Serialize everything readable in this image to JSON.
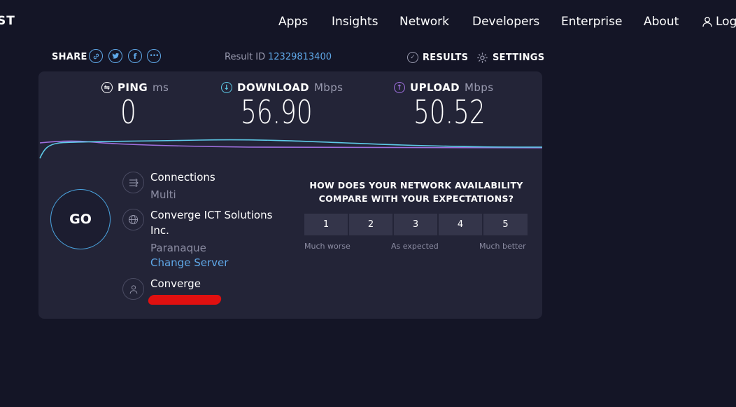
{
  "header": {
    "logo": "ST",
    "nav": [
      "Apps",
      "Insights",
      "Network",
      "Developers",
      "Enterprise",
      "About"
    ],
    "login": "Log"
  },
  "share": {
    "label": "SHARE",
    "icons": [
      "link-icon",
      "twitter-icon",
      "facebook-icon",
      "more-icon"
    ]
  },
  "result": {
    "label": "Result ID",
    "id": "12329813400"
  },
  "tools": {
    "results": "RESULTS",
    "settings": "SETTINGS"
  },
  "metrics": {
    "ping": {
      "label": "PING",
      "unit": "ms",
      "value": "0"
    },
    "download": {
      "label": "DOWNLOAD",
      "unit": "Mbps",
      "value": "56.90"
    },
    "upload": {
      "label": "UPLOAD",
      "unit": "Mbps",
      "value": "50.52"
    }
  },
  "go_label": "GO",
  "connections": {
    "title": "Connections",
    "value": "Multi"
  },
  "server": {
    "title_line1": "Converge ICT Solutions",
    "title_line2": "Inc.",
    "location": "Paranaque",
    "change": "Change Server"
  },
  "isp": {
    "name": "Converge"
  },
  "survey": {
    "question_line1": "HOW DOES YOUR NETWORK AVAILABILITY",
    "question_line2": "COMPARE WITH YOUR EXPECTATIONS?",
    "options": [
      "1",
      "2",
      "3",
      "4",
      "5"
    ],
    "labels": {
      "low": "Much worse",
      "mid": "As expected",
      "high": "Much better"
    }
  },
  "colors": {
    "background": "#141526",
    "panel": "#232437",
    "accent": "#5fa8e8",
    "download": "#5ecbe8",
    "upload": "#a070e0"
  }
}
